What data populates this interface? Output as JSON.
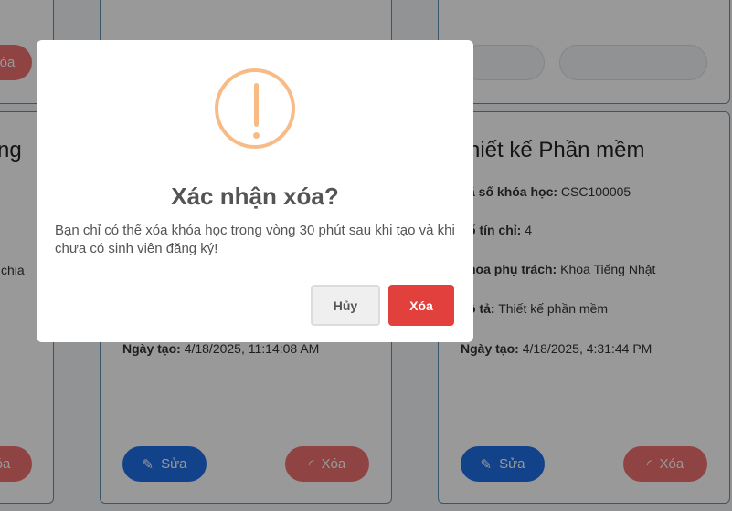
{
  "cards": {
    "left": {
      "title_fragment": "ng",
      "desc_fragment": "chia",
      "delete_label": "Xóa"
    },
    "middle": {
      "created_label": "Ngày tạo:",
      "created_value": "4/18/2025, 11:14:08 AM",
      "edit_label": "Sửa",
      "delete_label": "Xóa"
    },
    "right": {
      "title": "hiết kế Phần mềm",
      "code_label": "ã số khóa học:",
      "code_value": "CSC100005",
      "credits_label": "ố tín chỉ:",
      "credits_value": "4",
      "faculty_label": "hoa phụ trách:",
      "faculty_value": "Khoa Tiếng Nhật",
      "desc_label": "ô tả:",
      "desc_value": "Thiết kế phần mềm",
      "created_label": "Ngày tạo:",
      "created_value": "4/18/2025, 4:31:44 PM",
      "edit_label": "Sửa",
      "delete_label": "Xóa"
    }
  },
  "dialog": {
    "icon": "warning-icon",
    "title": "Xác nhận xóa?",
    "message": "Bạn chỉ có thể xóa khóa học trong vòng 30 phút sau khi tạo và khi chưa có sinh viên đăng ký!",
    "cancel_label": "Hủy",
    "confirm_label": "Xóa"
  },
  "colors": {
    "edit_button": "#1f6fe5",
    "delete_button": "#f07070",
    "confirm_button": "#e2403d",
    "warning": "#f8bb86"
  }
}
